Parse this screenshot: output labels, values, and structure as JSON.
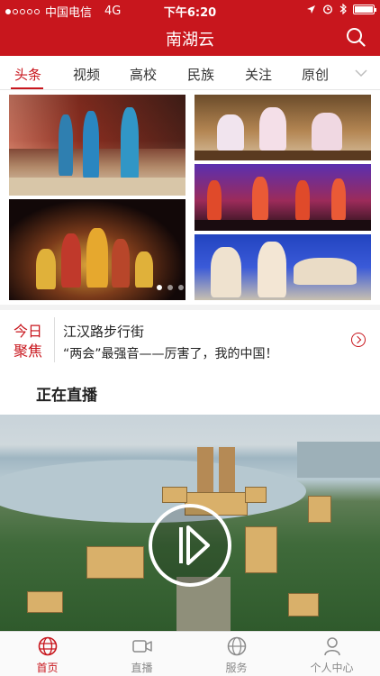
{
  "status_bar": {
    "carrier": "中国电信",
    "network": "4G",
    "time": "下午6:20",
    "battery_fraction": 1.0
  },
  "nav": {
    "title": "南湖云",
    "search_icon": "search-icon"
  },
  "tabs": {
    "items": [
      "头条",
      "视频",
      "高校",
      "民族",
      "关注",
      "原创"
    ],
    "active_index": 0,
    "more_icon": "chevron-down-icon"
  },
  "gallery": {
    "page_count": 3,
    "active_page": 0
  },
  "focus": {
    "badge": "今日聚焦",
    "line1": "江汉路步行街",
    "line2": "“两会”最强音——厉害了，我的中国！"
  },
  "live": {
    "section_title": "正在直播",
    "play_icon": "play-icon"
  },
  "tabbar": {
    "items": [
      {
        "label": "首页",
        "icon": "globe-icon"
      },
      {
        "label": "直播",
        "icon": "video-camera-icon"
      },
      {
        "label": "服务",
        "icon": "globe-grid-icon"
      },
      {
        "label": "个人中心",
        "icon": "user-icon"
      }
    ],
    "active_index": 0
  },
  "colors": {
    "brand_red": "#c8161d",
    "inactive_gray": "#8a8a8a"
  }
}
